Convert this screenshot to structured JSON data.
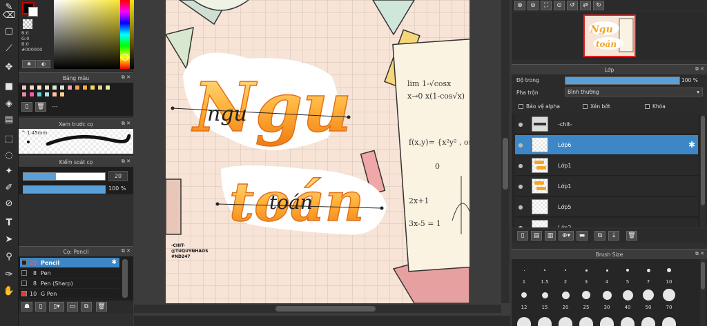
{
  "toolbar_left": {
    "icons": [
      "pencil-tool-icon",
      "eraser-icon",
      "rect-select-icon",
      "brush-icon",
      "move-icon",
      "fill-rect-icon",
      "bucket-icon",
      "gradient-icon",
      "lasso-icon",
      "lasso-poly-icon",
      "magic-wand-icon",
      "select-pen-icon",
      "select-erase-icon",
      "text-icon",
      "operation-icon",
      "eyedropper-icon",
      "hand-icon"
    ]
  },
  "color_panel": {
    "r": "R:0",
    "g": "G:0",
    "b": "B:0",
    "hex": "#000000"
  },
  "palette_panel": {
    "title": "Bảng màu",
    "empty_name": "---",
    "colors": [
      "#f2c6c6",
      "#f5d6c2",
      "#f8e3c4",
      "#e9e3c8",
      "#dde8d0",
      "#d3e6e2",
      "#f0a6a6",
      "#f4a25b",
      "#f7b03f",
      "#f5d95a",
      "#f1c7a1",
      "#e4f0a0",
      "#e98aa6",
      "#ff55aa",
      "#66cfd8",
      "#a7e0df",
      "#ffbfa8",
      "#ffd28a"
    ]
  },
  "brush_preview_panel": {
    "title": "Xem trước cọ",
    "size": "1.45mm"
  },
  "brush_control_panel": {
    "title": "Kiểm soát cọ",
    "size_value": "20",
    "opacity_value": "100 %",
    "size_fraction": 0.4,
    "opacity_fraction": 1.0
  },
  "brush_list_panel": {
    "title": "Cọ: Pencil",
    "items": [
      {
        "size": "20",
        "name": "Pencil",
        "selected": true
      },
      {
        "size": "8",
        "name": "Pen",
        "selected": false
      },
      {
        "size": "8",
        "name": "Pen (Sharp)",
        "selected": false
      },
      {
        "size": "10",
        "name": "G Pen",
        "selected": false
      }
    ]
  },
  "canvas": {
    "art_title_line1": "Ngu",
    "art_title_line2": "toán",
    "art_script_line1": "ngu",
    "art_script_line2": "toán",
    "watermark_lines": [
      "-CHIT-",
      "@TUQUYNHAOS",
      "#ND247"
    ],
    "math_lines": [
      "lim  1-√cosx",
      "x→0  x(1-cos√x)",
      "f(x,y)= {x²y²  , os",
      "0",
      "2x+1",
      "3x-5 = 1"
    ]
  },
  "nav_panel": {
    "icons": [
      "zoom-in-icon",
      "zoom-out-icon",
      "fit-icon",
      "zoom-reset-icon",
      "rotate-left-icon",
      "flip-icon",
      "rotate-right-icon"
    ]
  },
  "layer_panel": {
    "title": "Lớp",
    "opacity_label": "Độ trong",
    "opacity_value": "100 %",
    "opacity_fraction": 1.0,
    "blend_label": "Pha trộn",
    "blend_value": "Bình thường",
    "protect_alpha": "Bảo vệ alpha",
    "clipping": "Xén bớt",
    "lock": "Khóa",
    "layers": [
      {
        "name": "-chit-",
        "selected": false
      },
      {
        "name": "Lớp6",
        "selected": true
      },
      {
        "name": "Lớp1",
        "selected": false
      },
      {
        "name": "Lớp1",
        "selected": false
      },
      {
        "name": "Lớp5",
        "selected": false
      },
      {
        "name": "Lớp2",
        "selected": false
      }
    ]
  },
  "brush_size_panel": {
    "title": "Brush Size",
    "sizes_row1": [
      "1",
      "1.5",
      "2",
      "3",
      "4",
      "5",
      "7",
      "10"
    ],
    "sizes_row2": [
      "12",
      "15",
      "20",
      "25",
      "30",
      "40",
      "50",
      "70"
    ]
  },
  "colors": {
    "accent": "#3d87c6",
    "panel_bg": "#2f2f2f",
    "canvas_bg": "#f7e4d6",
    "orange": "#f5a623"
  }
}
